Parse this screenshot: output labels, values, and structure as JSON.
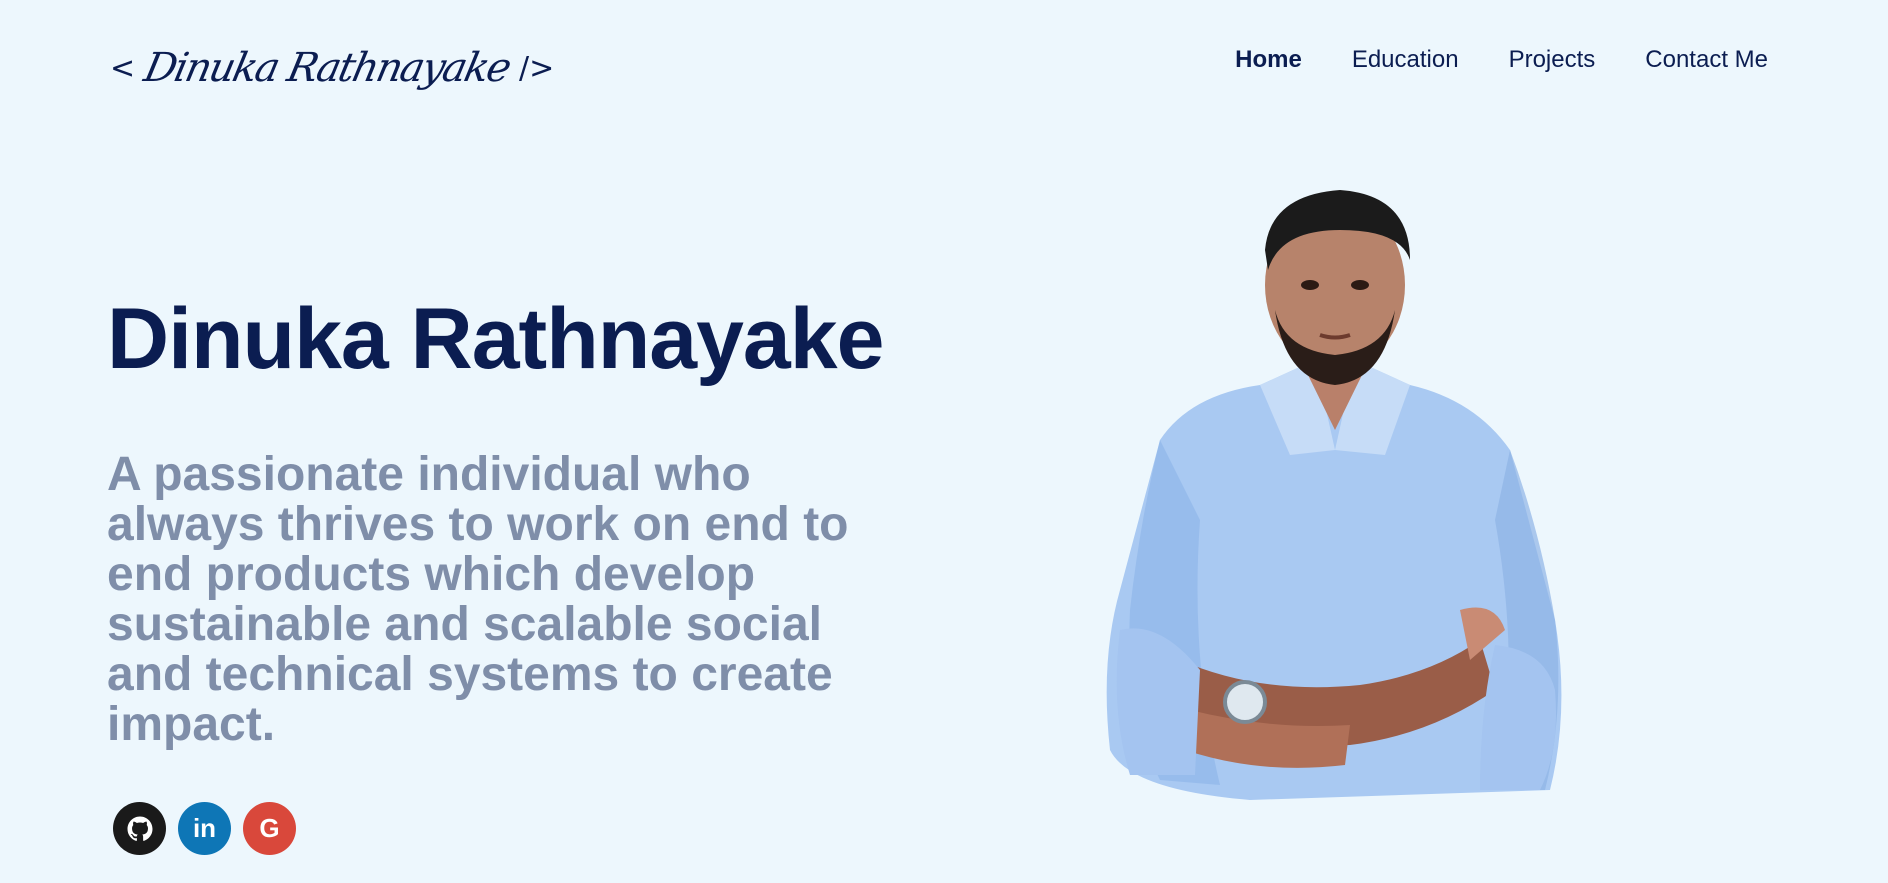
{
  "header": {
    "logo_open": "<",
    "logo_name": "Dinuka Rathnayake",
    "logo_close": "/>"
  },
  "nav": {
    "items": [
      {
        "label": "Home",
        "active": true
      },
      {
        "label": "Education",
        "active": false
      },
      {
        "label": "Projects",
        "active": false
      },
      {
        "label": "Contact Me",
        "active": false
      }
    ]
  },
  "hero": {
    "title": "Dinuka Rathnayake",
    "description": "A passionate individual who always thrives to work on end to end products which develop sustainable and scalable social and technical systems to create impact."
  },
  "socials": [
    {
      "icon": "github-icon",
      "color": "#1a1a1a",
      "glyph": ""
    },
    {
      "icon": "linkedin-icon",
      "color": "#0e76b6",
      "glyph": "in"
    },
    {
      "icon": "google-icon",
      "color": "#d9483b",
      "glyph": "G"
    }
  ],
  "colors": {
    "background": "#edf7fd",
    "primary": "#0b1d51",
    "muted": "#7f8ea9"
  }
}
